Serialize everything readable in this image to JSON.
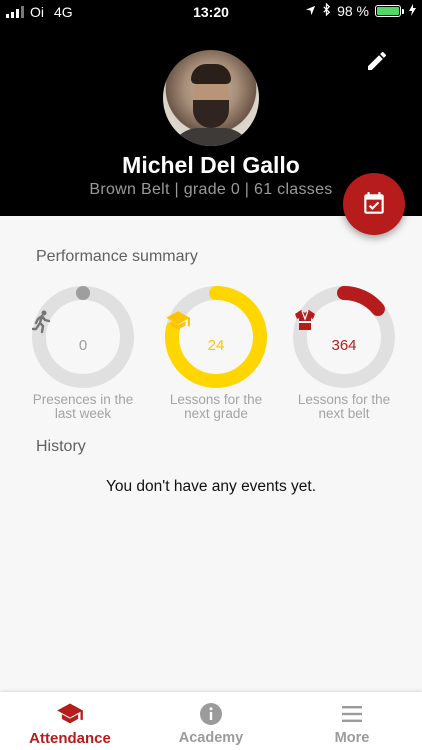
{
  "status_bar": {
    "carrier": "Oi",
    "network": "4G",
    "time": "13:20",
    "battery": "98 %"
  },
  "profile": {
    "name": "Michel Del Gallo",
    "subtitle": "Brown Belt | grade 0 | 61 classes"
  },
  "summary": {
    "title": "Performance summary",
    "stats": [
      {
        "value": "0",
        "caption_line1": "Presences in the",
        "caption_line2": "last week",
        "color": "#9e9e9e",
        "progress": 0.0
      },
      {
        "value": "24",
        "caption_line1": "Lessons for the",
        "caption_line2": "next grade",
        "color": "#ffd600",
        "progress": 0.78
      },
      {
        "value": "364",
        "caption_line1": "Lessons for the",
        "caption_line2": "next belt",
        "color": "#b71c1c",
        "progress": 0.14
      }
    ]
  },
  "history": {
    "title": "History",
    "empty_message": "You don't have any events yet."
  },
  "bottom_nav": {
    "items": [
      {
        "label": "Attendance",
        "icon": "graduation-cap-icon",
        "active": true
      },
      {
        "label": "Academy",
        "icon": "info-icon",
        "active": false
      },
      {
        "label": "More",
        "icon": "menu-icon",
        "active": false
      }
    ]
  },
  "colors": {
    "accent": "#b71c1c",
    "header_bg": "#000000",
    "ring_track": "#e0e0e0"
  }
}
